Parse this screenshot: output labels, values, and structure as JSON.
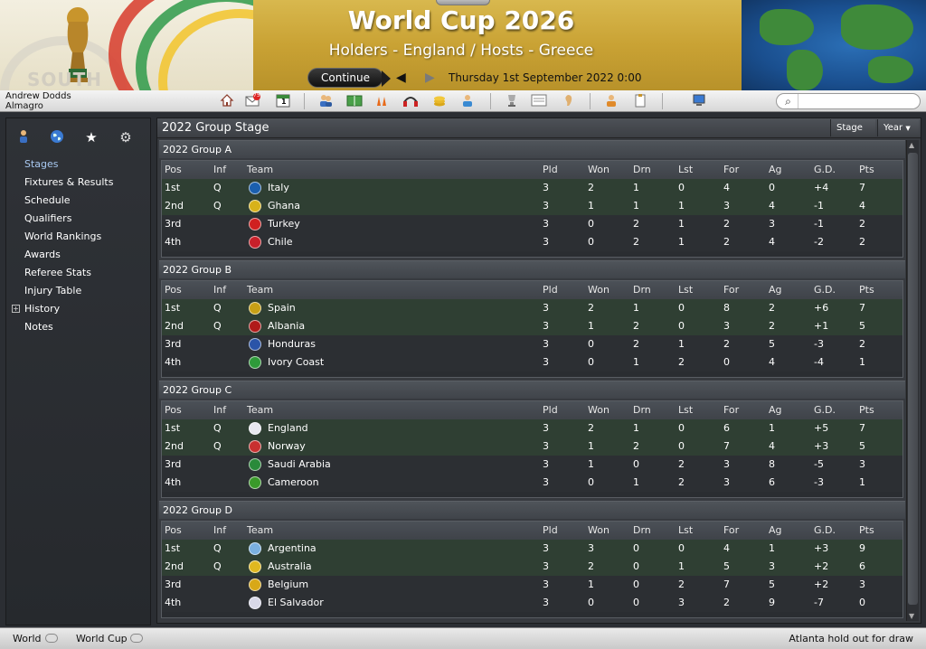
{
  "header": {
    "title": "World Cup 2026",
    "subtitle": "Holders - England / Hosts - Greece",
    "continue_label": "Continue",
    "date": "Thursday 1st September 2022 0:00",
    "logo_word": "SOUTH"
  },
  "user": {
    "name": "Andrew Dodds",
    "club": "Almagro"
  },
  "toolbar": {
    "icons": [
      "home-icon",
      "inbox-icon",
      "calendar-icon",
      "squad-icon",
      "tactics-icon",
      "training-icon",
      "scouting-icon",
      "finances-icon",
      "staff-icon",
      "competitions-icon",
      "news-icon",
      "rumours-icon",
      "manager-icon",
      "clipboard-icon",
      "computer-icon"
    ],
    "inbox_count": "75",
    "calendar_day": "1",
    "search_placeholder": ""
  },
  "sidebar": {
    "icons": [
      "player-icon",
      "globe-icon",
      "star-icon",
      "gears-icon"
    ],
    "items": [
      {
        "label": "Stages",
        "active": true
      },
      {
        "label": "Fixtures & Results"
      },
      {
        "label": "Schedule"
      },
      {
        "label": "Qualifiers"
      },
      {
        "label": "World Rankings"
      },
      {
        "label": "Awards"
      },
      {
        "label": "Referee Stats"
      },
      {
        "label": "Injury Table"
      },
      {
        "label": "History",
        "expandable": true
      },
      {
        "label": "Notes"
      }
    ],
    "expander_symbol": "+"
  },
  "main": {
    "title": "2022 Group Stage",
    "stage_dropdown": "Stage",
    "year_dropdown": "Year",
    "columns": [
      "Pos",
      "Inf",
      "Team",
      "Pld",
      "Won",
      "Drn",
      "Lst",
      "For",
      "Ag",
      "G.D.",
      "Pts"
    ],
    "groups": [
      {
        "name": "2022 Group A",
        "rows": [
          {
            "pos": "1st",
            "inf": "Q",
            "team": "Italy",
            "flag": "#1b5fae",
            "pld": "3",
            "won": "2",
            "drn": "1",
            "lst": "0",
            "for": "4",
            "ag": "0",
            "gd": "+4",
            "pts": "7"
          },
          {
            "pos": "2nd",
            "inf": "Q",
            "team": "Ghana",
            "flag": "#d8b21a",
            "pld": "3",
            "won": "1",
            "drn": "1",
            "lst": "1",
            "for": "3",
            "ag": "4",
            "gd": "-1",
            "pts": "4"
          },
          {
            "pos": "3rd",
            "inf": "",
            "team": "Turkey",
            "flag": "#d02020",
            "pld": "3",
            "won": "0",
            "drn": "2",
            "lst": "1",
            "for": "2",
            "ag": "3",
            "gd": "-1",
            "pts": "2"
          },
          {
            "pos": "4th",
            "inf": "",
            "team": "Chile",
            "flag": "#c8202a",
            "pld": "3",
            "won": "0",
            "drn": "2",
            "lst": "1",
            "for": "2",
            "ag": "4",
            "gd": "-2",
            "pts": "2"
          }
        ]
      },
      {
        "name": "2022 Group B",
        "rows": [
          {
            "pos": "1st",
            "inf": "Q",
            "team": "Spain",
            "flag": "#c8a016",
            "pld": "3",
            "won": "2",
            "drn": "1",
            "lst": "0",
            "for": "8",
            "ag": "2",
            "gd": "+6",
            "pts": "7"
          },
          {
            "pos": "2nd",
            "inf": "Q",
            "team": "Albania",
            "flag": "#b01a1a",
            "pld": "3",
            "won": "1",
            "drn": "2",
            "lst": "0",
            "for": "3",
            "ag": "2",
            "gd": "+1",
            "pts": "5"
          },
          {
            "pos": "3rd",
            "inf": "",
            "team": "Honduras",
            "flag": "#2a54a8",
            "pld": "3",
            "won": "0",
            "drn": "2",
            "lst": "1",
            "for": "2",
            "ag": "5",
            "gd": "-3",
            "pts": "2"
          },
          {
            "pos": "4th",
            "inf": "",
            "team": "Ivory Coast",
            "flag": "#2e9a3a",
            "pld": "3",
            "won": "0",
            "drn": "1",
            "lst": "2",
            "for": "0",
            "ag": "4",
            "gd": "-4",
            "pts": "1"
          }
        ]
      },
      {
        "name": "2022 Group C",
        "rows": [
          {
            "pos": "1st",
            "inf": "Q",
            "team": "England",
            "flag": "#e8e8f0",
            "pld": "3",
            "won": "2",
            "drn": "1",
            "lst": "0",
            "for": "6",
            "ag": "1",
            "gd": "+5",
            "pts": "7"
          },
          {
            "pos": "2nd",
            "inf": "Q",
            "team": "Norway",
            "flag": "#c83030",
            "pld": "3",
            "won": "1",
            "drn": "2",
            "lst": "0",
            "for": "7",
            "ag": "4",
            "gd": "+3",
            "pts": "5"
          },
          {
            "pos": "3rd",
            "inf": "",
            "team": "Saudi Arabia",
            "flag": "#2a8a3a",
            "pld": "3",
            "won": "1",
            "drn": "0",
            "lst": "2",
            "for": "3",
            "ag": "8",
            "gd": "-5",
            "pts": "3"
          },
          {
            "pos": "4th",
            "inf": "",
            "team": "Cameroon",
            "flag": "#3a9a2a",
            "pld": "3",
            "won": "0",
            "drn": "1",
            "lst": "2",
            "for": "3",
            "ag": "6",
            "gd": "-3",
            "pts": "1"
          }
        ]
      },
      {
        "name": "2022 Group D",
        "rows": [
          {
            "pos": "1st",
            "inf": "Q",
            "team": "Argentina",
            "flag": "#7ab0e0",
            "pld": "3",
            "won": "3",
            "drn": "0",
            "lst": "0",
            "for": "4",
            "ag": "1",
            "gd": "+3",
            "pts": "9"
          },
          {
            "pos": "2nd",
            "inf": "Q",
            "team": "Australia",
            "flag": "#e0b820",
            "pld": "3",
            "won": "2",
            "drn": "0",
            "lst": "1",
            "for": "5",
            "ag": "3",
            "gd": "+2",
            "pts": "6"
          },
          {
            "pos": "3rd",
            "inf": "",
            "team": "Belgium",
            "flag": "#d8a818",
            "pld": "3",
            "won": "1",
            "drn": "0",
            "lst": "2",
            "for": "7",
            "ag": "5",
            "gd": "+2",
            "pts": "3"
          },
          {
            "pos": "4th",
            "inf": "",
            "team": "El Salvador",
            "flag": "#d8d8e8",
            "pld": "3",
            "won": "0",
            "drn": "0",
            "lst": "3",
            "for": "2",
            "ag": "9",
            "gd": "-7",
            "pts": "0"
          }
        ]
      }
    ]
  },
  "statusbar": {
    "crumbs": [
      "World",
      "World Cup"
    ],
    "news": "Atlanta hold out for draw"
  },
  "colors": {
    "qualified_row": "#2f3f33",
    "normal_row": "#2c2f33",
    "active_menu": "#a8c8f0",
    "header_gold": "#c9a234"
  }
}
